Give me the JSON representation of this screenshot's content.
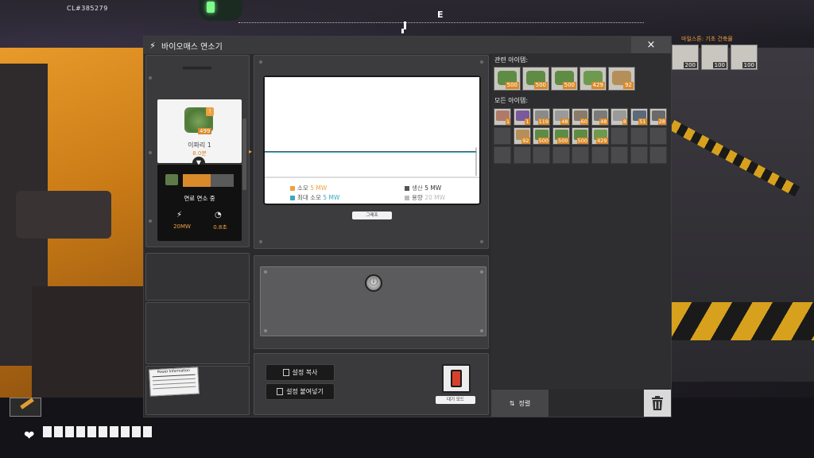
{
  "hud": {
    "client_id": "CL#385279",
    "compass_heading": "E",
    "build_tray_title": "마일스톤: 기초 건축물",
    "build_tray_counts": [
      "200",
      "100",
      "100"
    ],
    "health_segments": 10
  },
  "window": {
    "title": "바이오매스 연소기",
    "close_label": "×"
  },
  "fuel": {
    "item_name": "이파리 1",
    "burn_time": "8.0분",
    "item_count": "499",
    "lock_glyph": "!",
    "status": "연료 연소 중",
    "burn_progress": 0.55,
    "power_value": "20MW",
    "time_value": "0.8초"
  },
  "chart_data": {
    "type": "line",
    "series": [
      {
        "name": "소모",
        "value_label": "5 MW",
        "color": "#f0a040"
      },
      {
        "name": "최대 소모",
        "value_label": "5 MW",
        "color": "#38a8c6"
      },
      {
        "name": "생산",
        "value_label": "5 MW",
        "color": "#555555"
      },
      {
        "name": "용량",
        "value_label": "20 MW",
        "color": "#bbbbbb"
      }
    ],
    "ylim": [
      0,
      20
    ],
    "flat_level": 5
  },
  "graph_button": "그래프",
  "standby_label": "대기 모드",
  "buttons": {
    "copy_settings": "설정 복사",
    "paste_settings": "설정 붙여넣기"
  },
  "power_card_title": "Power Information",
  "inventory": {
    "related_title": "관련 아이템:",
    "related_items": [
      {
        "count": "500",
        "color": "#5f8c45"
      },
      {
        "count": "500",
        "color": "#5f8c45"
      },
      {
        "count": "500",
        "color": "#5f8c45"
      },
      {
        "count": "429",
        "color": "#6d9a4e"
      },
      {
        "count": "92",
        "color": "#b58f5a"
      }
    ],
    "all_title": "모든 아이템:",
    "all_items_row1": [
      {
        "count": "1",
        "color": "#b07a6a"
      },
      {
        "count": "1",
        "color": "#7a5a9c"
      },
      {
        "count": "119",
        "color": "#8a8a8a"
      },
      {
        "count": "48",
        "color": "#9a9a9a"
      },
      {
        "count": "60",
        "color": "#8a7a6a"
      },
      {
        "count": "48",
        "color": "#7a7a7a"
      },
      {
        "count": "8",
        "color": "#9a9a9a"
      },
      {
        "count": "51",
        "color": "#5a6a7a"
      },
      {
        "count": "28",
        "color": "#6a6a6a"
      }
    ],
    "all_items_row2": [
      {
        "count": "",
        "color": ""
      },
      {
        "count": "92",
        "color": "#b58f5a"
      },
      {
        "count": "500",
        "color": "#5f8c45"
      },
      {
        "count": "500",
        "color": "#5f8c45"
      },
      {
        "count": "500",
        "color": "#5f8c45"
      },
      {
        "count": "429",
        "color": "#6d9a4e"
      }
    ],
    "sort_label": "정렬"
  }
}
